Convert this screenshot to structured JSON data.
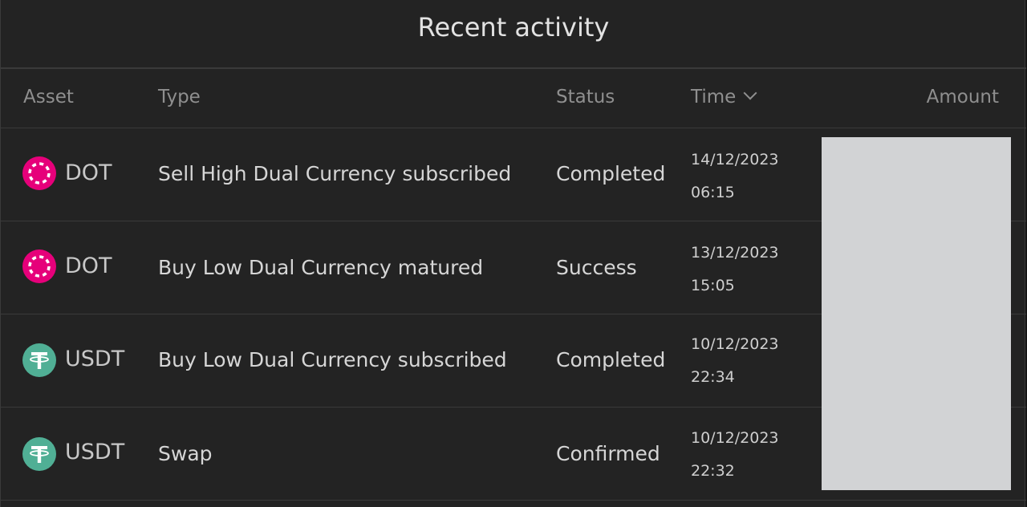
{
  "panel": {
    "title": "Recent activity"
  },
  "table": {
    "headers": {
      "asset": "Asset",
      "type": "Type",
      "status": "Status",
      "time": "Time",
      "amount": "Amount"
    },
    "sort_icon": "chevron-down-icon",
    "rows": [
      {
        "asset": "DOT",
        "coin_icon": "polkadot-icon",
        "type": "Sell High Dual Currency subscribed",
        "status": "Completed",
        "date": "14/12/2023",
        "time": "06:15"
      },
      {
        "asset": "DOT",
        "coin_icon": "polkadot-icon",
        "type": "Buy Low Dual Currency matured",
        "status": "Success",
        "date": "13/12/2023",
        "time": "15:05"
      },
      {
        "asset": "USDT",
        "coin_icon": "tether-icon",
        "type": "Buy Low Dual Currency subscribed",
        "status": "Completed",
        "date": "10/12/2023",
        "time": "22:34"
      },
      {
        "asset": "USDT",
        "coin_icon": "tether-icon",
        "type": "Swap",
        "status": "Confirmed",
        "date": "10/12/2023",
        "time": "22:32"
      }
    ]
  },
  "colors": {
    "background": "#232323",
    "polkadot": "#e6007a",
    "tether": "#50af95",
    "redaction": "#d2d3d5"
  }
}
